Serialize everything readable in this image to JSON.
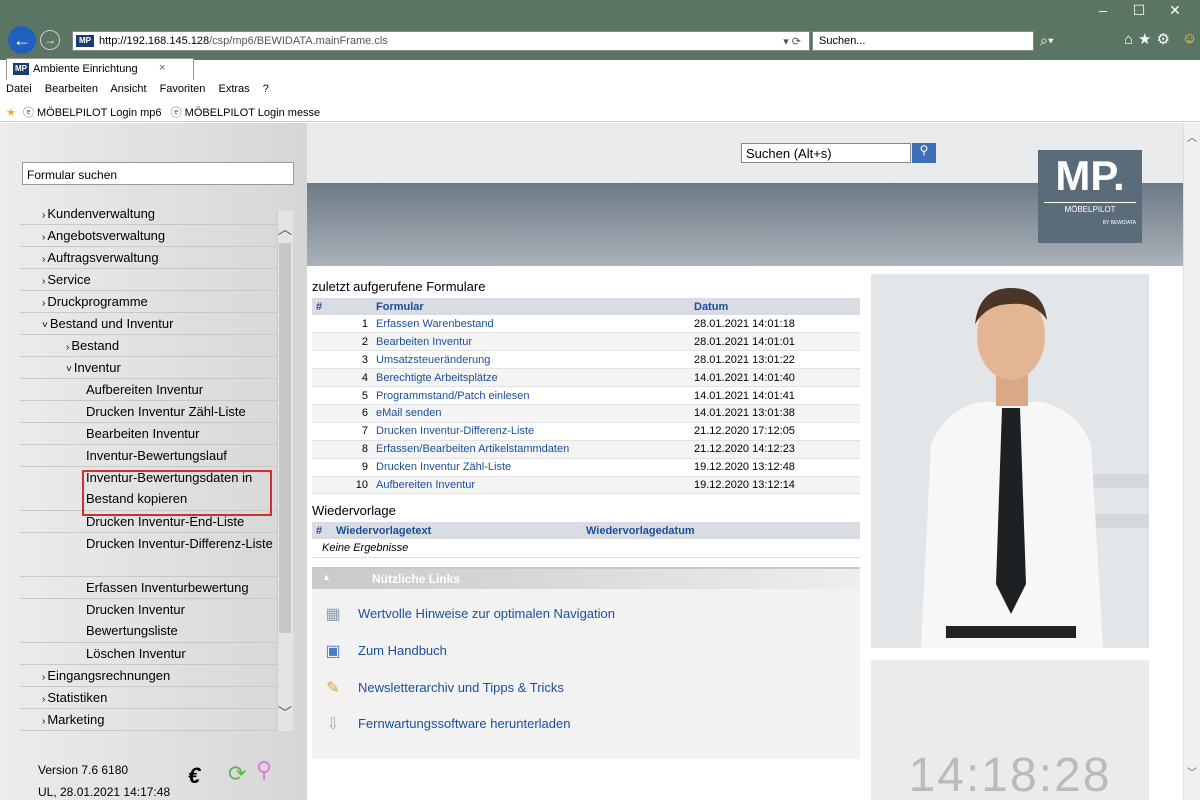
{
  "browser": {
    "url_host": "http://192.168.145.128",
    "url_path": "/csp/mp6/BEWIDATA.mainFrame.cls",
    "search_placeholder": "Suchen...",
    "tab_title": "Ambiente Einrichtung",
    "min": "–",
    "max": "☐",
    "close": "✕",
    "back": "←",
    "forward": "→",
    "refresh": "▾ ⟳"
  },
  "menubar": [
    "Datei",
    "Bearbeiten",
    "Ansicht",
    "Favoriten",
    "Extras",
    "?"
  ],
  "favorites": [
    "MÖBELPILOT Login mp6",
    "MÖBELPILOT Login messe"
  ],
  "sidebar": {
    "search_placeholder": "Formular suchen",
    "items": [
      {
        "label": "Kundenverwaltung",
        "level": 1,
        "prefix": "›"
      },
      {
        "label": "Angebotsverwaltung",
        "level": 1,
        "prefix": "›"
      },
      {
        "label": "Auftragsverwaltung",
        "level": 1,
        "prefix": "›"
      },
      {
        "label": "Service",
        "level": 1,
        "prefix": "›"
      },
      {
        "label": "Druckprogramme",
        "level": 1,
        "prefix": "›"
      },
      {
        "label": "Bestand und Inventur",
        "level": 1,
        "prefix": "˅"
      },
      {
        "label": "Bestand",
        "level": 2,
        "prefix": "›"
      },
      {
        "label": "Inventur",
        "level": 2,
        "prefix": "˅"
      },
      {
        "label": "Aufbereiten Inventur",
        "level": 3
      },
      {
        "label": "Drucken Inventur Zähl-Liste",
        "level": 3
      },
      {
        "label": "Bearbeiten Inventur",
        "level": 3
      },
      {
        "label": "Inventur-Bewertungslauf",
        "level": 3
      },
      {
        "label": "Inventur-Bewertungsdaten in Bestand kopieren",
        "level": 3,
        "wrap": true
      },
      {
        "label": "Drucken Inventur-End-Liste",
        "level": 3
      },
      {
        "label": "Drucken Inventur-Differenz-Liste",
        "level": 3,
        "wrap": true
      },
      {
        "label": "Erfassen Inventurbewertung",
        "level": 3
      },
      {
        "label": "Drucken Inventur Bewertungsliste",
        "level": 3,
        "wrap": true
      },
      {
        "label": "Löschen Inventur",
        "level": 3
      },
      {
        "label": "Eingangsrechnungen",
        "level": 1,
        "prefix": "›"
      },
      {
        "label": "Statistiken",
        "level": 1,
        "prefix": "›"
      },
      {
        "label": "Marketing",
        "level": 1,
        "prefix": "›"
      }
    ],
    "version": "Version 7.6 6180",
    "user_date": "UL, 28.01.2021 14:17:48"
  },
  "header": {
    "search_placeholder": "Suchen (Alt+s)",
    "logo": "MP.",
    "logo_sub": "MÖBELPILOT",
    "logo_sub2": "BY BEWIDATA"
  },
  "recent": {
    "title": "zuletzt aufgerufene Formulare",
    "columns": [
      "#",
      "Formular",
      "Datum"
    ],
    "rows": [
      [
        "1",
        "Erfassen Warenbestand",
        "28.01.2021 14:01:18"
      ],
      [
        "2",
        "Bearbeiten Inventur",
        "28.01.2021 14:01:01"
      ],
      [
        "3",
        "Umsatzsteueränderung",
        "28.01.2021 13:01:22"
      ],
      [
        "4",
        "Berechtigte Arbeitsplätze",
        "14.01.2021 14:01:40"
      ],
      [
        "5",
        "Programmstand/Patch einlesen",
        "14.01.2021 14:01:41"
      ],
      [
        "6",
        "eMail senden",
        "14.01.2021 13:01:38"
      ],
      [
        "7",
        "Drucken Inventur-Differenz-Liste",
        "21.12.2020 17:12:05"
      ],
      [
        "8",
        "Erfassen/Bearbeiten Artikelstammdaten",
        "21.12.2020 14:12:23"
      ],
      [
        "9",
        "Drucken Inventur Zähl-Liste",
        "19.12.2020 13:12:48"
      ],
      [
        "10",
        "Aufbereiten Inventur",
        "19.12.2020 13:12:14"
      ]
    ]
  },
  "wiedervorlage": {
    "title": "Wiedervorlage",
    "columns": [
      "#",
      "Wiedervorlagetext",
      "Wiedervorlagedatum"
    ],
    "empty": "Keine Ergebnisse"
  },
  "links": {
    "title": "Nützliche Links",
    "items": [
      "Wertvolle Hinweise zur optimalen Navigation",
      "Zum Handbuch",
      "Newsletterarchiv und Tipps & Tricks",
      "Fernwartungssoftware herunterladen"
    ]
  },
  "clock": "14:18:28"
}
